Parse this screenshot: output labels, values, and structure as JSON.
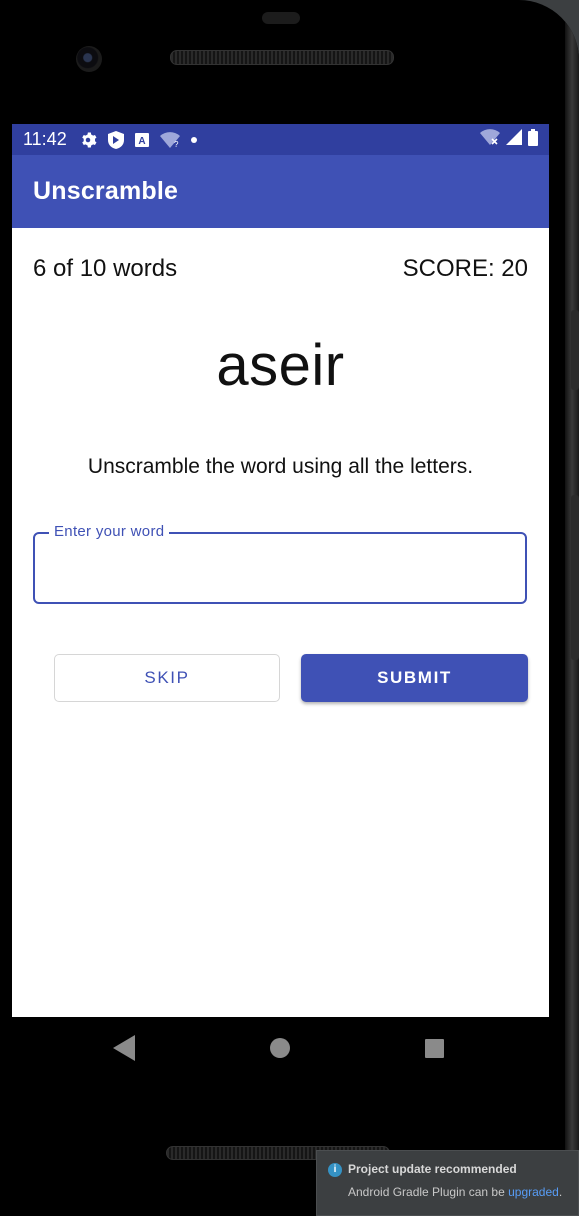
{
  "status_bar": {
    "time": "11:42",
    "icons": [
      "gear-icon",
      "shield-icon",
      "a-box-icon",
      "wifi-question-icon",
      "dot-icon"
    ],
    "right_icons": [
      "wifi-off-icon",
      "signal-icon",
      "battery-icon"
    ]
  },
  "app_bar": {
    "title": "Unscramble"
  },
  "game": {
    "word_count": "6 of 10 words",
    "score": "SCORE: 20",
    "scrambled_word": "aseir",
    "instructions": "Unscramble the word using all the letters.",
    "input_label": "Enter your word",
    "input_value": "",
    "skip_label": "SKIP",
    "submit_label": "SUBMIT"
  },
  "nav_bar": {
    "buttons": [
      "back-icon",
      "home-icon",
      "recents-icon"
    ]
  },
  "notification": {
    "title": "Project update recommended",
    "body_prefix": "Android Gradle Plugin can be ",
    "link": "upgraded",
    "body_suffix": "."
  },
  "colors": {
    "status_bar": "#303f9f",
    "app_bar": "#3f51b5",
    "accent": "#3f51b5"
  }
}
